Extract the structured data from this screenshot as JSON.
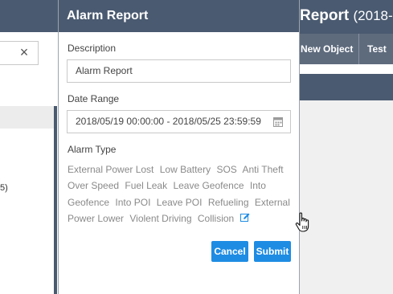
{
  "background": {
    "close_glyph": "×",
    "left_fragment": "5)",
    "report_title": "Report",
    "report_title_suffix": "(2018-",
    "tabs": [
      "New Object",
      "Test"
    ]
  },
  "modal": {
    "title": "Alarm Report",
    "description": {
      "label": "Description",
      "value": "Alarm Report"
    },
    "date_range": {
      "label": "Date Range",
      "value": "2018/05/19 00:00:00 - 2018/05/25 23:59:59",
      "icon": "calendar-icon"
    },
    "alarm_type": {
      "label": "Alarm Type",
      "options": [
        "External Power Lost",
        "Low Battery",
        "SOS",
        "Anti Theft",
        "Over Speed",
        "Fuel Leak",
        "Leave Geofence",
        "Into Geofence",
        "Into POI",
        "Leave POI",
        "Refueling",
        "External Power Lower",
        "Violent Driving",
        "Collision"
      ],
      "select_all_icon": "edit-checkbox-icon"
    },
    "buttons": {
      "cancel": "Cancel",
      "submit": "Submit"
    }
  },
  "colors": {
    "header": "#4a5a70",
    "accent": "#1e8ce3",
    "option_text": "#8a8a8a"
  }
}
